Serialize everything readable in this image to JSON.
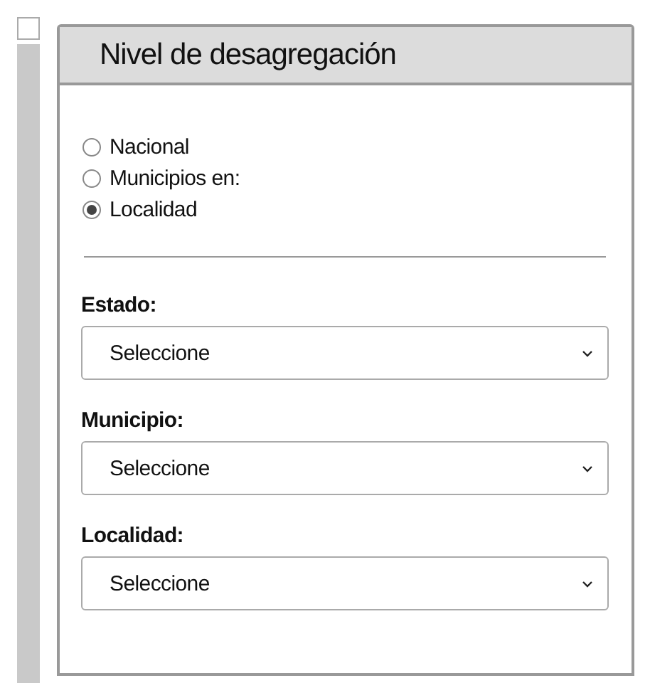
{
  "toggle": {
    "checked": false
  },
  "panel": {
    "title": "Nivel de desagregación",
    "options": [
      {
        "label": "Nacional",
        "selected": false
      },
      {
        "label": "Municipios en:",
        "selected": false
      },
      {
        "label": "Localidad",
        "selected": true
      }
    ],
    "fields": [
      {
        "label": "Estado:",
        "value": "Seleccione"
      },
      {
        "label": "Municipio:",
        "value": "Seleccione"
      },
      {
        "label": "Localidad:",
        "value": "Seleccione"
      }
    ]
  }
}
